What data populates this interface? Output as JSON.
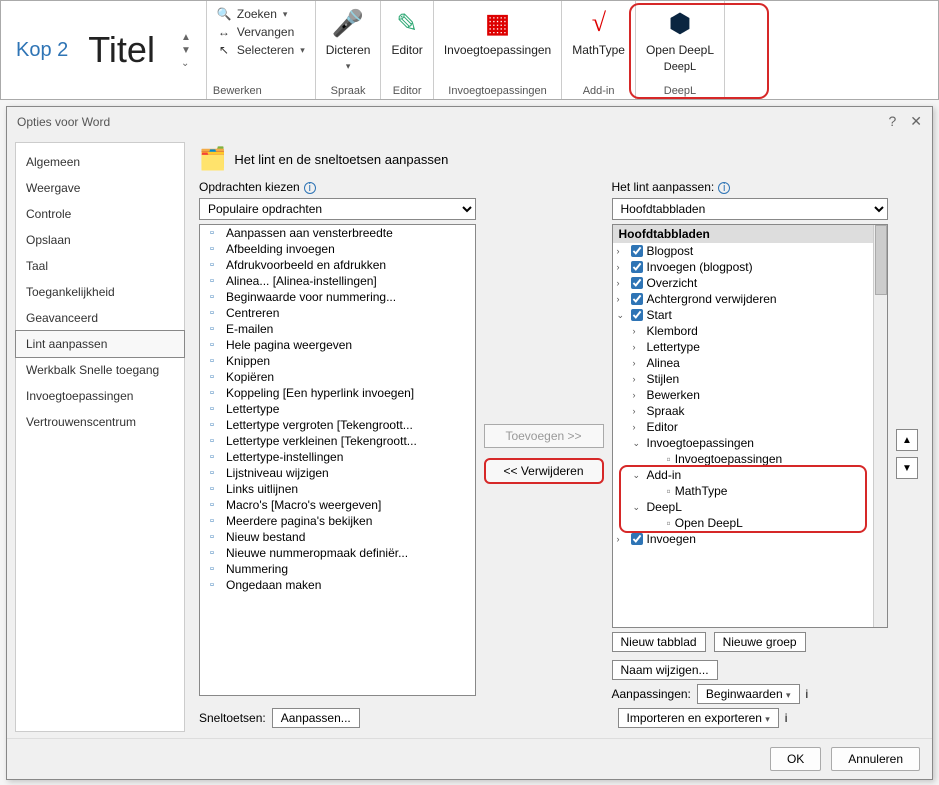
{
  "ribbon": {
    "style_kop2": "Kop 2",
    "style_titel": "Titel",
    "edit": {
      "zoeken": "Zoeken",
      "vervangen": "Vervangen",
      "selecteren": "Selecteren",
      "group": "Bewerken"
    },
    "dicteren": {
      "label": "Dicteren",
      "group": "Spraak"
    },
    "editor": {
      "label": "Editor",
      "group": "Editor"
    },
    "invoeg": {
      "label": "Invoegtoepassingen",
      "group": "Invoegtoepassingen"
    },
    "mathtype": {
      "label": "MathType",
      "group": "Add-in"
    },
    "deepl": {
      "label": "Open DeepL",
      "sub": "DeepL",
      "group": "DeepL"
    }
  },
  "dialog": {
    "title": "Opties voor Word",
    "sidebar": [
      "Algemeen",
      "Weergave",
      "Controle",
      "Opslaan",
      "Taal",
      "Toegankelijkheid",
      "Geavanceerd",
      "Lint aanpassen",
      "Werkbalk Snelle toegang",
      "Invoegtoepassingen",
      "Vertrouwenscentrum"
    ],
    "sidebar_active_index": 7,
    "heading": "Het lint en de sneltoetsen aanpassen",
    "left": {
      "label": "Opdrachten kiezen",
      "select": "Populaire opdrachten",
      "items": [
        "Aanpassen aan vensterbreedte",
        "Afbeelding invoegen",
        "Afdrukvoorbeeld en afdrukken",
        "Alinea... [Alinea-instellingen]",
        "Beginwaarde voor nummering...",
        "Centreren",
        "E-mailen",
        "Hele pagina weergeven",
        "Knippen",
        "Kopiëren",
        "Koppeling [Een hyperlink invoegen]",
        "Lettertype",
        "Lettertype vergroten [Tekengroott...",
        "Lettertype verkleinen [Tekengroott...",
        "Lettertype-instellingen",
        "Lijstniveau wijzigen",
        "Links uitlijnen",
        "Macro's [Macro's weergeven]",
        "Meerdere pagina's bekijken",
        "Nieuw bestand",
        "Nieuwe nummeropmaak definiër...",
        "Nummering",
        "Ongedaan maken"
      ]
    },
    "right": {
      "label": "Het lint aanpassen:",
      "select": "Hoofdtabbladen",
      "root": "Hoofdtabbladen",
      "tabs": [
        {
          "name": "Blogpost",
          "checked": true,
          "expanded": false
        },
        {
          "name": "Invoegen (blogpost)",
          "checked": true,
          "expanded": false
        },
        {
          "name": "Overzicht",
          "checked": true,
          "expanded": false
        },
        {
          "name": "Achtergrond verwijderen",
          "checked": true,
          "expanded": false
        },
        {
          "name": "Start",
          "checked": true,
          "expanded": true,
          "groups": [
            {
              "name": "Klembord"
            },
            {
              "name": "Lettertype"
            },
            {
              "name": "Alinea"
            },
            {
              "name": "Stijlen"
            },
            {
              "name": "Bewerken"
            },
            {
              "name": "Spraak"
            },
            {
              "name": "Editor"
            },
            {
              "name": "Invoegtoepassingen",
              "expanded": true,
              "children": [
                {
                  "name": "Invoegtoepassingen",
                  "icon": true
                }
              ]
            },
            {
              "name": "Add-in",
              "expanded": true,
              "children": [
                {
                  "name": "MathType",
                  "icon": true
                }
              ]
            },
            {
              "name": "DeepL",
              "expanded": true,
              "children": [
                {
                  "name": "Open DeepL",
                  "icon": true
                }
              ]
            }
          ]
        },
        {
          "name": "Invoegen",
          "checked": true,
          "expanded": false
        }
      ]
    },
    "mid": {
      "add": "Toevoegen >>",
      "remove": "<< Verwijderen"
    },
    "below": {
      "nieuw_tabblad": "Nieuw tabblad",
      "nieuwe_groep": "Nieuwe groep",
      "naam_wijzigen": "Naam wijzigen...",
      "aanpassingen": "Aanpassingen:",
      "beginwaarden": "Beginwaarden",
      "import_export": "Importeren en exporteren"
    },
    "sneltoetsen": {
      "label": "Sneltoetsen:",
      "btn": "Aanpassen..."
    },
    "footer": {
      "ok": "OK",
      "cancel": "Annuleren"
    }
  }
}
